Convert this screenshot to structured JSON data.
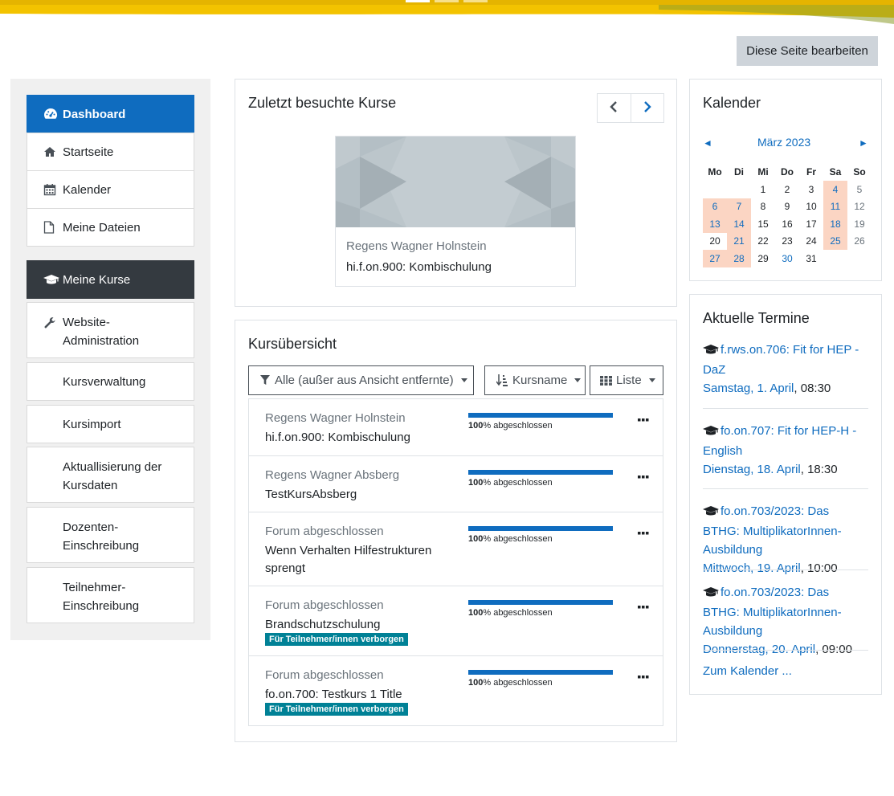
{
  "header": {
    "edit_button": "Diese Seite bearbeiten"
  },
  "nav": {
    "items": [
      {
        "label": "Dashboard",
        "icon": "dashboard-icon"
      },
      {
        "label": "Startseite",
        "icon": "home-icon"
      },
      {
        "label": "Kalender",
        "icon": "calendar-icon"
      },
      {
        "label": "Meine Dateien",
        "icon": "file-icon"
      },
      {
        "label": "Meine Kurse",
        "icon": "graduation-cap-icon"
      },
      {
        "label": "Website-Administration",
        "icon": "wrench-icon"
      },
      {
        "label": "Kursverwaltung"
      },
      {
        "label": "Kursimport"
      },
      {
        "label": "Aktuallisierung der Kursdaten"
      },
      {
        "label": "Dozenten-Einschreibung"
      },
      {
        "label": "Teilnehmer-Einschreibung"
      }
    ]
  },
  "recent": {
    "title": "Zuletzt besuchte Kurse",
    "course": {
      "category": "Regens Wagner Holnstein",
      "name": "hi.f.on.900: Kombischulung"
    }
  },
  "overview": {
    "title": "Kursübersicht",
    "filter": "Alle (außer aus Ansicht entfernte)",
    "sort": "Kursname",
    "view": "Liste",
    "progress_suffix": "% abgeschlossen",
    "courses": [
      {
        "category": "Regens Wagner Holnstein",
        "name": "hi.f.on.900: Kombischulung",
        "progress": "100",
        "badge": ""
      },
      {
        "category": "Regens Wagner Absberg",
        "name": "TestKursAbsberg",
        "progress": "100",
        "badge": ""
      },
      {
        "category": "Forum abgeschlossen",
        "name": "Wenn Verhalten Hilfestrukturen sprengt",
        "progress": "100",
        "badge": ""
      },
      {
        "category": "Forum abgeschlossen",
        "name": "Brandschutzschulung",
        "progress": "100",
        "badge": "Für Teilnehmer/innen verborgen"
      },
      {
        "category": "Forum abgeschlossen",
        "name": "fo.on.700: Testkurs 1 Title",
        "progress": "100",
        "badge": "Für Teilnehmer/innen verborgen"
      }
    ]
  },
  "calendar": {
    "title": "Kalender",
    "month": "März 2023",
    "prev": "◄",
    "next": "►",
    "weekdays": [
      "Mo",
      "Di",
      "Mi",
      "Do",
      "Fr",
      "Sa",
      "So"
    ],
    "weeks": [
      [
        "",
        "",
        "1",
        "2",
        "3",
        "4",
        "5"
      ],
      [
        "6",
        "7",
        "8",
        "9",
        "10",
        "11",
        "12"
      ],
      [
        "13",
        "14",
        "15",
        "16",
        "17",
        "18",
        "19"
      ],
      [
        "20",
        "21",
        "22",
        "23",
        "24",
        "25",
        "26"
      ],
      [
        "27",
        "28",
        "29",
        "30",
        "31",
        "",
        ""
      ]
    ]
  },
  "events": {
    "title": "Aktuelle Termine",
    "items": [
      {
        "title": "f.rws.on.706: Fit for HEP - DaZ",
        "date": "Samstag, 1. April",
        "time": ", 08:30"
      },
      {
        "title": "fo.on.707: Fit for HEP-H - English",
        "date": "Dienstag, 18. April",
        "time": ", 18:30"
      },
      {
        "title": "fo.on.703/2023: Das BTHG: MultiplikatorInnen-Ausbildung",
        "date": "Mittwoch, 19. April",
        "time": ", 10:00"
      },
      {
        "title": "fo.on.703/2023: Das BTHG: MultiplikatorInnen-Ausbildung",
        "date": "Donnerstag, 20. April",
        "time": ", 09:00"
      }
    ],
    "footer_link": "Zum Kalender ..."
  }
}
